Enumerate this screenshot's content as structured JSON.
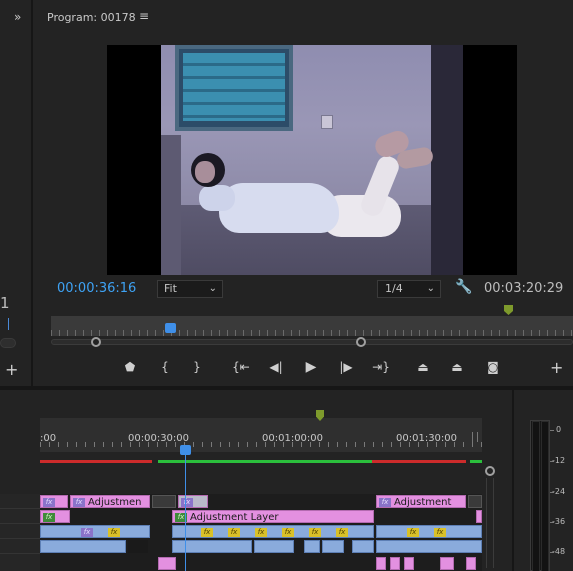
{
  "program": {
    "title": "Program: 00178",
    "menu_icon": "hamburger-icon",
    "current_timecode": "00:00:36:16",
    "fit_label": "Fit",
    "resolution_label": "1/4",
    "duration_timecode": "00:03:20:29",
    "settings_icon": "wrench-icon",
    "playhead_fraction": 0.22,
    "accent_color": "#3ea3f5"
  },
  "left_panel": {
    "expand_icon": "double-chevron-right-icon",
    "fragment_label": "1",
    "add_icon": "plus-icon"
  },
  "transport": {
    "buttons": [
      {
        "name": "add-marker-button",
        "icon": "marker-icon",
        "glyph": "⬟"
      },
      {
        "name": "mark-in-button",
        "icon": "mark-in-icon",
        "glyph": "{"
      },
      {
        "name": "mark-out-button",
        "icon": "mark-out-icon",
        "glyph": "}"
      },
      {
        "name": "go-to-in-button",
        "icon": "go-to-in-icon",
        "glyph": "{⇤"
      },
      {
        "name": "step-back-button",
        "icon": "step-back-icon",
        "glyph": "◀|"
      },
      {
        "name": "play-button",
        "icon": "play-icon",
        "glyph": "▶"
      },
      {
        "name": "step-forward-button",
        "icon": "step-forward-icon",
        "glyph": "|▶"
      },
      {
        "name": "go-to-out-button",
        "icon": "go-to-out-icon",
        "glyph": "⇥}"
      },
      {
        "name": "lift-button",
        "icon": "lift-icon",
        "glyph": "⏏"
      },
      {
        "name": "extract-button",
        "icon": "extract-icon",
        "glyph": "⏏"
      },
      {
        "name": "export-frame-button",
        "icon": "camera-icon",
        "glyph": "📷"
      }
    ],
    "add_icon": "plus-icon"
  },
  "timeline": {
    "ruler_labels": [
      ":00",
      "00:00:30:00",
      "00:01:00:00",
      "00:01:30:00"
    ],
    "clips": {
      "adjustment_1": "Adjustmen",
      "adjustment_2": "Adjustment",
      "adjustment_layer": "Adjustment Layer"
    },
    "fx_label": "fx",
    "work_area_colors": {
      "rendered": "#2bbf3c",
      "unrendered": "#cc2b2b"
    }
  },
  "audio_meter": {
    "labels": [
      "0",
      "-12",
      "-24",
      "-36",
      "-48"
    ]
  }
}
